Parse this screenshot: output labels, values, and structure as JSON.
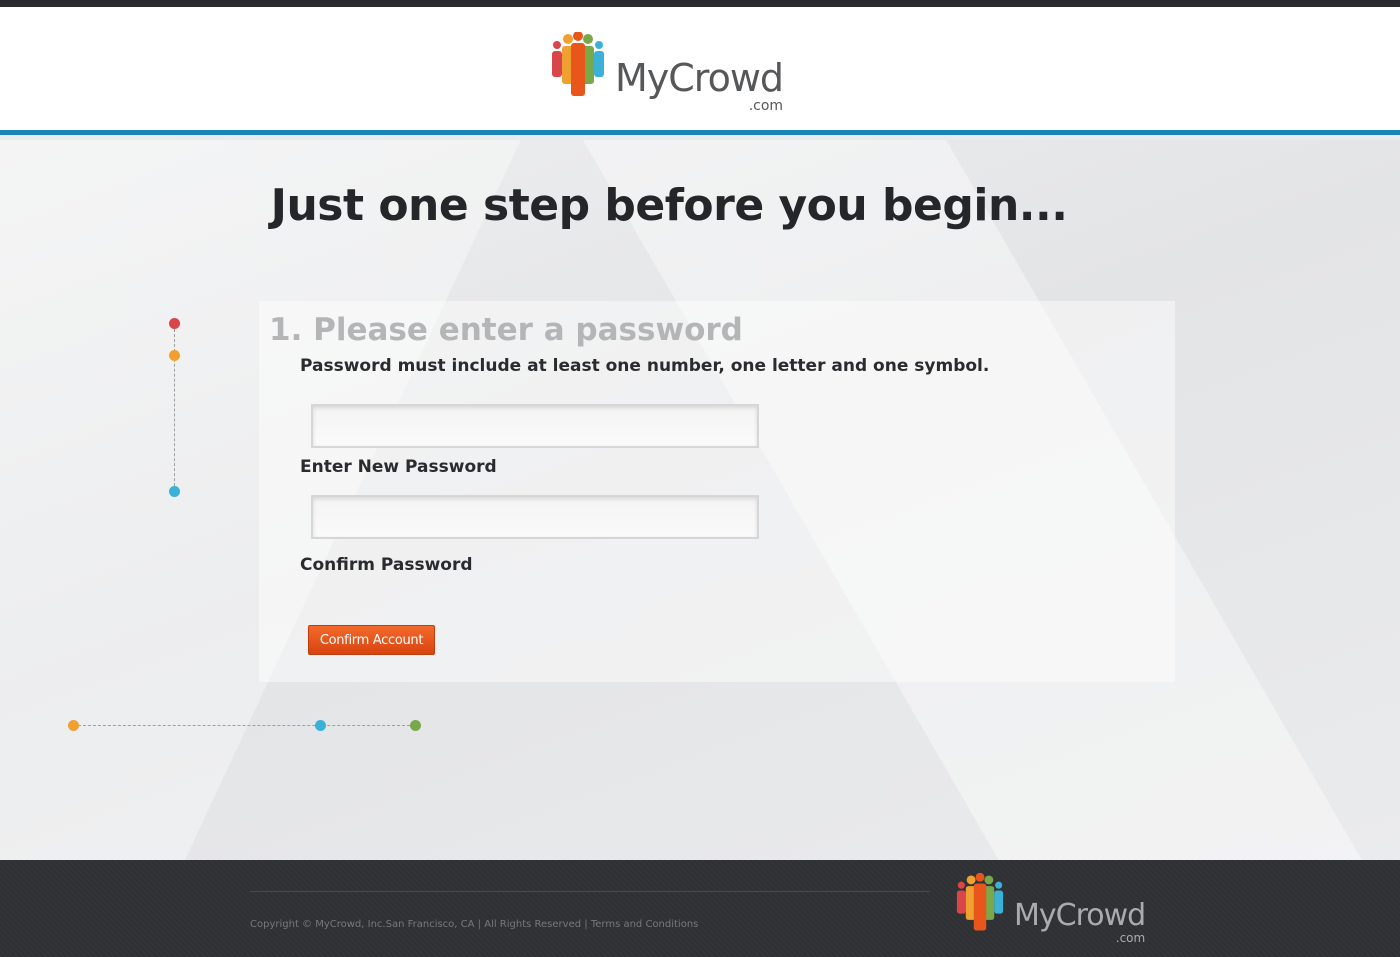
{
  "brand": {
    "name": "MyCrowd",
    "suffix": ".com",
    "colors": {
      "header_rule": "#1a83b8",
      "button": "#e8561b",
      "dot_red": "#d9464a",
      "dot_orange": "#f0a031",
      "dot_blue": "#3bb1d8",
      "dot_green": "#77a94b"
    }
  },
  "page": {
    "headline": "Just one step before you begin...",
    "step_title": "1. Please enter a password",
    "hint": "Password must include at least one number, one letter and one symbol."
  },
  "form": {
    "new_password": {
      "label": "Enter New Password",
      "value": "",
      "placeholder": ""
    },
    "confirm_password": {
      "label": "Confirm Password",
      "value": "",
      "placeholder": ""
    },
    "submit_label": "Confirm Account"
  },
  "footer": {
    "copyright": "Copyright © MyCrowd, Inc.San Francisco, CA",
    "separator": "|",
    "rights": "All Rights Reserved",
    "terms_link": "Terms and Conditions"
  },
  "icons": [
    "people-logo-icon"
  ]
}
